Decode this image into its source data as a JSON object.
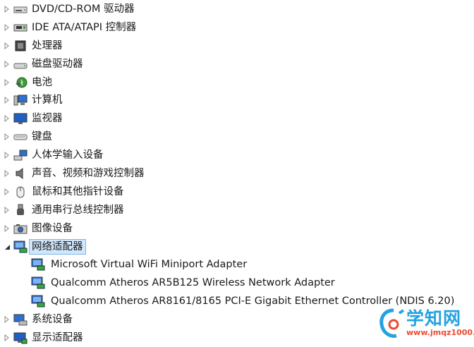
{
  "categories": [
    {
      "label": "DVD/CD-ROM 驱动器",
      "icon": "dvd-drive-icon",
      "expanded": false
    },
    {
      "label": "IDE ATA/ATAPI 控制器",
      "icon": "ide-controller-icon",
      "expanded": false
    },
    {
      "label": "处理器",
      "icon": "processor-icon",
      "expanded": false
    },
    {
      "label": "磁盘驱动器",
      "icon": "disk-drive-icon",
      "expanded": false
    },
    {
      "label": "电池",
      "icon": "battery-icon",
      "expanded": false
    },
    {
      "label": "计算机",
      "icon": "computer-icon",
      "expanded": false
    },
    {
      "label": "监视器",
      "icon": "monitor-icon",
      "expanded": false
    },
    {
      "label": "键盘",
      "icon": "keyboard-icon",
      "expanded": false
    },
    {
      "label": "人体学输入设备",
      "icon": "hid-icon",
      "expanded": false
    },
    {
      "label": "声音、视频和游戏控制器",
      "icon": "speaker-icon",
      "expanded": false
    },
    {
      "label": "鼠标和其他指针设备",
      "icon": "mouse-icon",
      "expanded": false
    },
    {
      "label": "通用串行总线控制器",
      "icon": "usb-icon",
      "expanded": false
    },
    {
      "label": "图像设备",
      "icon": "camera-icon",
      "expanded": false
    },
    {
      "label": "网络适配器",
      "icon": "network-adapter-icon",
      "expanded": true,
      "selected": true
    },
    {
      "label": "系统设备",
      "icon": "system-device-icon",
      "expanded": false
    },
    {
      "label": "显示适配器",
      "icon": "display-adapter-icon",
      "expanded": false
    }
  ],
  "network_adapters": [
    "Microsoft Virtual WiFi Miniport Adapter",
    "Qualcomm Atheros AR5B125 Wireless Network Adapter",
    "Qualcomm Atheros AR8161/8165 PCI-E Gigabit Ethernet Controller (NDIS 6.20)"
  ],
  "watermark": {
    "title": "学知网",
    "url": "www.jmqz1000.com"
  },
  "colors": {
    "selection_bg": "#cfe6fb",
    "selection_border": "#7db7e8",
    "watermark_blue": "#24a3e0",
    "watermark_red": "#e94b35"
  }
}
